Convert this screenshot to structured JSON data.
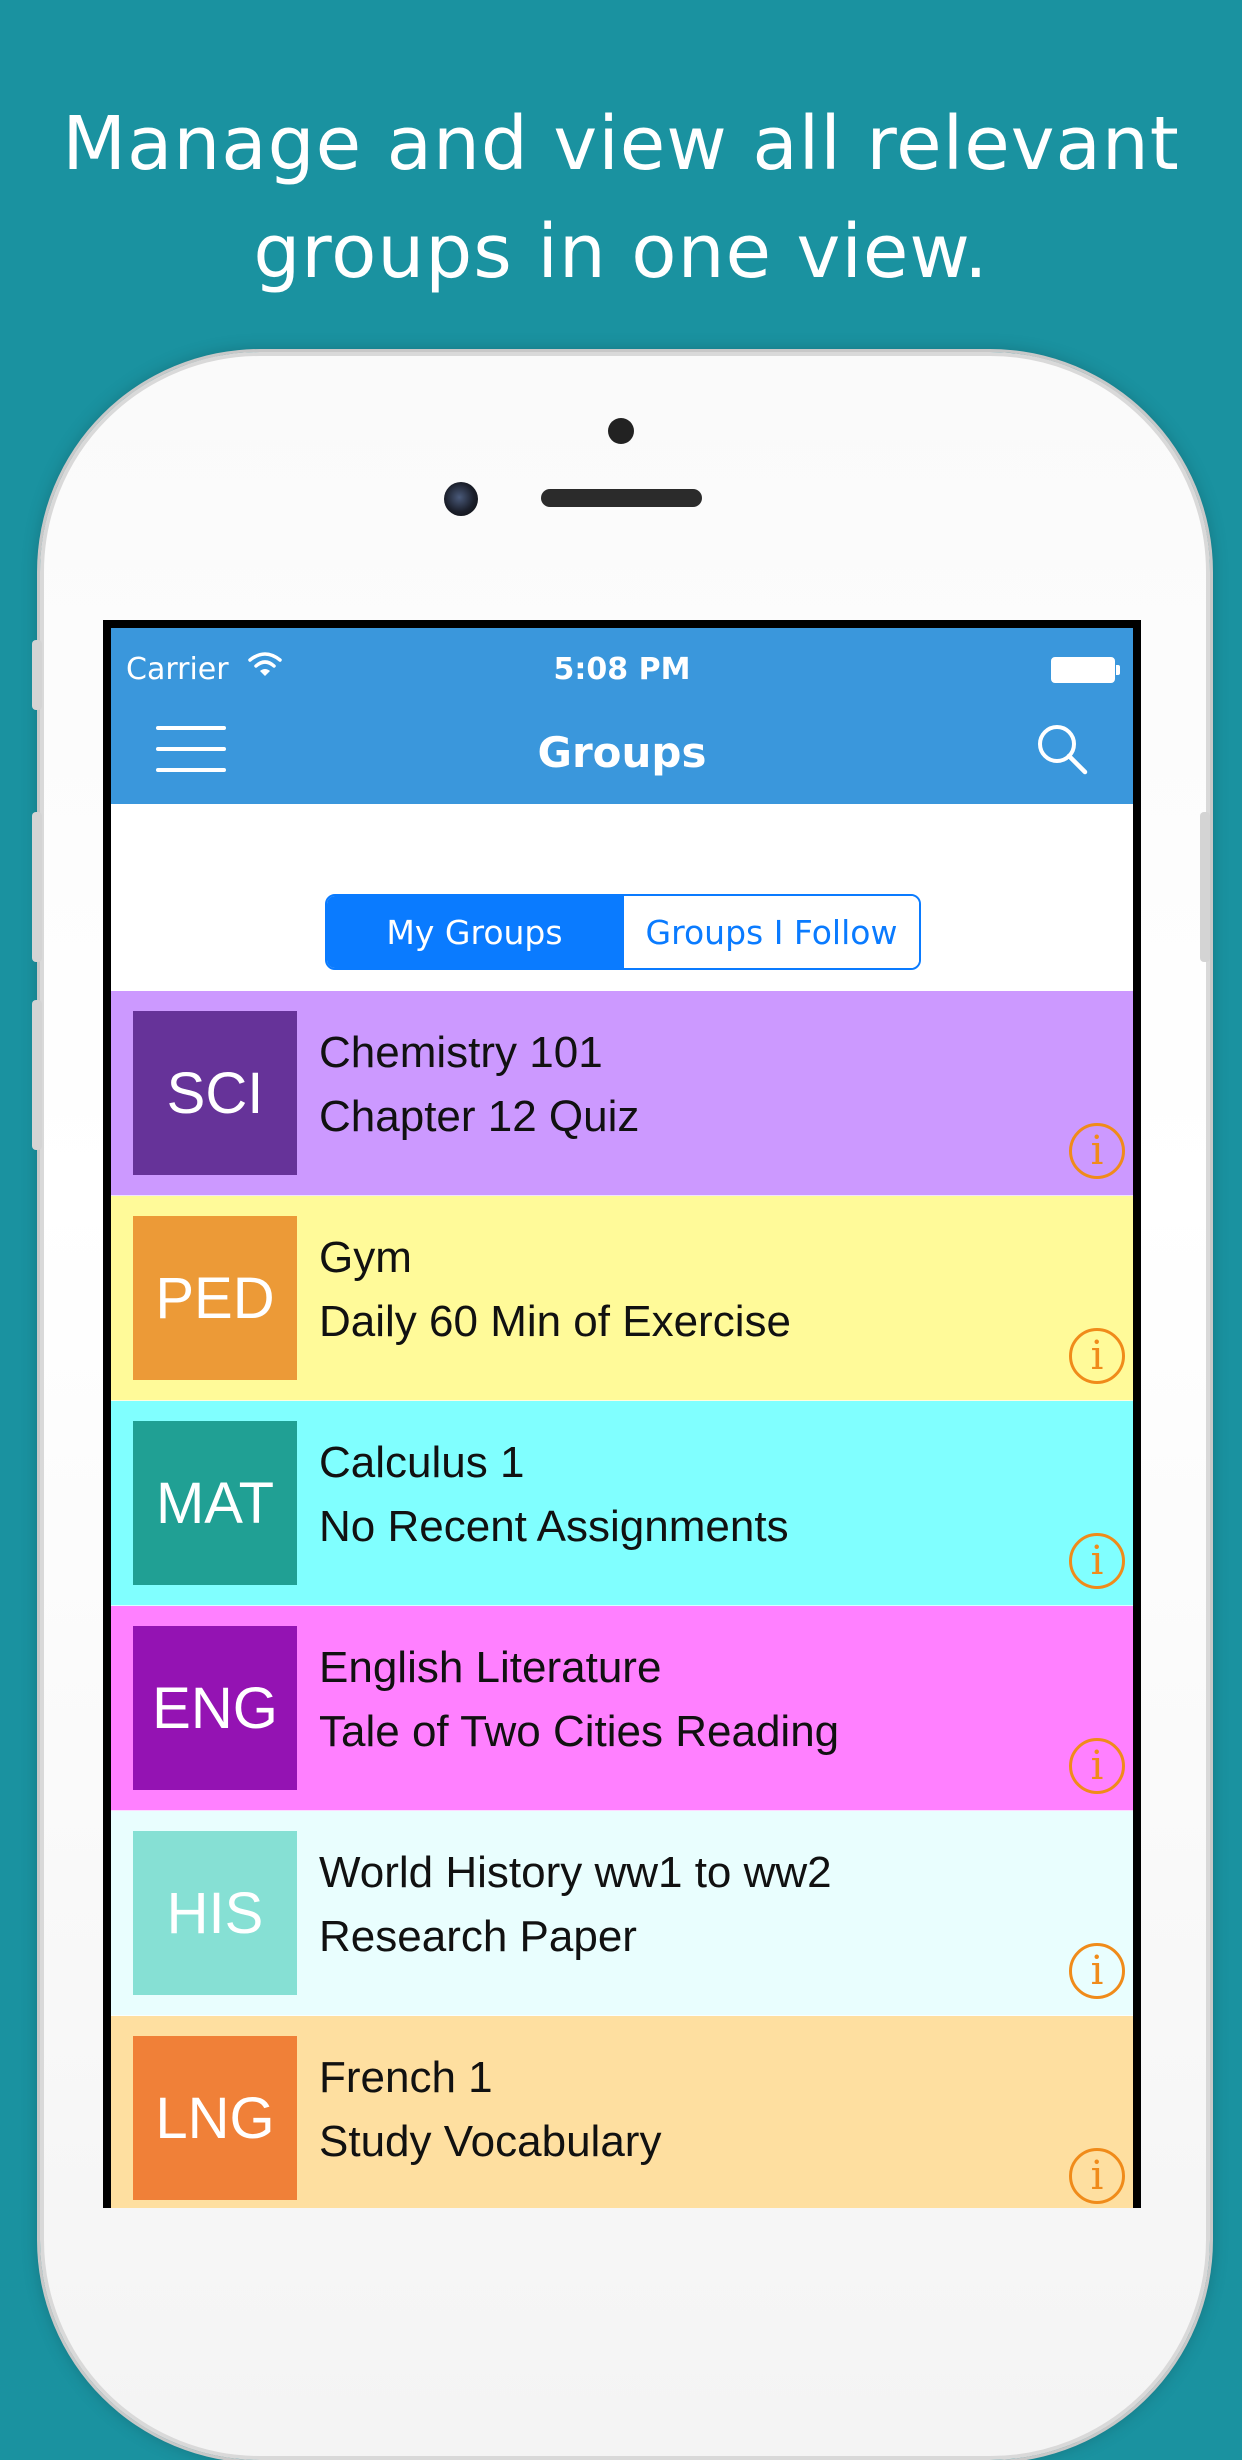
{
  "headline": {
    "line1": "Manage and view all relevant",
    "line2": "groups in one view."
  },
  "status_bar": {
    "carrier": "Carrier",
    "time": "5:08 PM"
  },
  "nav": {
    "title": "Groups",
    "menu_icon": "hamburger-menu-icon",
    "search_icon": "search-icon"
  },
  "segmented_control": {
    "selected": "My Groups",
    "options": [
      "My Groups",
      "Groups I Follow"
    ]
  },
  "groups": [
    {
      "code": "SCI",
      "title": "Chemistry 101",
      "subtitle": "Chapter 12 Quiz",
      "row_color": "#cc99ff",
      "badge_color": "#663399"
    },
    {
      "code": "PED",
      "title": "Gym",
      "subtitle": "Daily 60 Min of Exercise",
      "row_color": "#fffa99",
      "badge_color": "#ec9a37"
    },
    {
      "code": "MAT",
      "title": "Calculus 1",
      "subtitle": "No Recent Assignments",
      "row_color": "#80ffff",
      "badge_color": "#20a094"
    },
    {
      "code": "ENG",
      "title": "English Literature",
      "subtitle": "Tale of Two Cities Reading",
      "row_color": "#ff80ff",
      "badge_color": "#9413b3"
    },
    {
      "code": "HIS",
      "title": "World History ww1 to ww2",
      "subtitle": "Research Paper",
      "row_color": "#e9fefe",
      "badge_color": "#86e0d4"
    },
    {
      "code": "LNG",
      "title": "French 1",
      "subtitle": "Study Vocabulary",
      "row_color": "#fedfa0",
      "badge_color": "#f08038"
    }
  ],
  "colors": {
    "background": "#1a92a0",
    "navbar": "#3a97dc",
    "accent": "#0a7bff",
    "info_icon": "#f08b1a"
  }
}
